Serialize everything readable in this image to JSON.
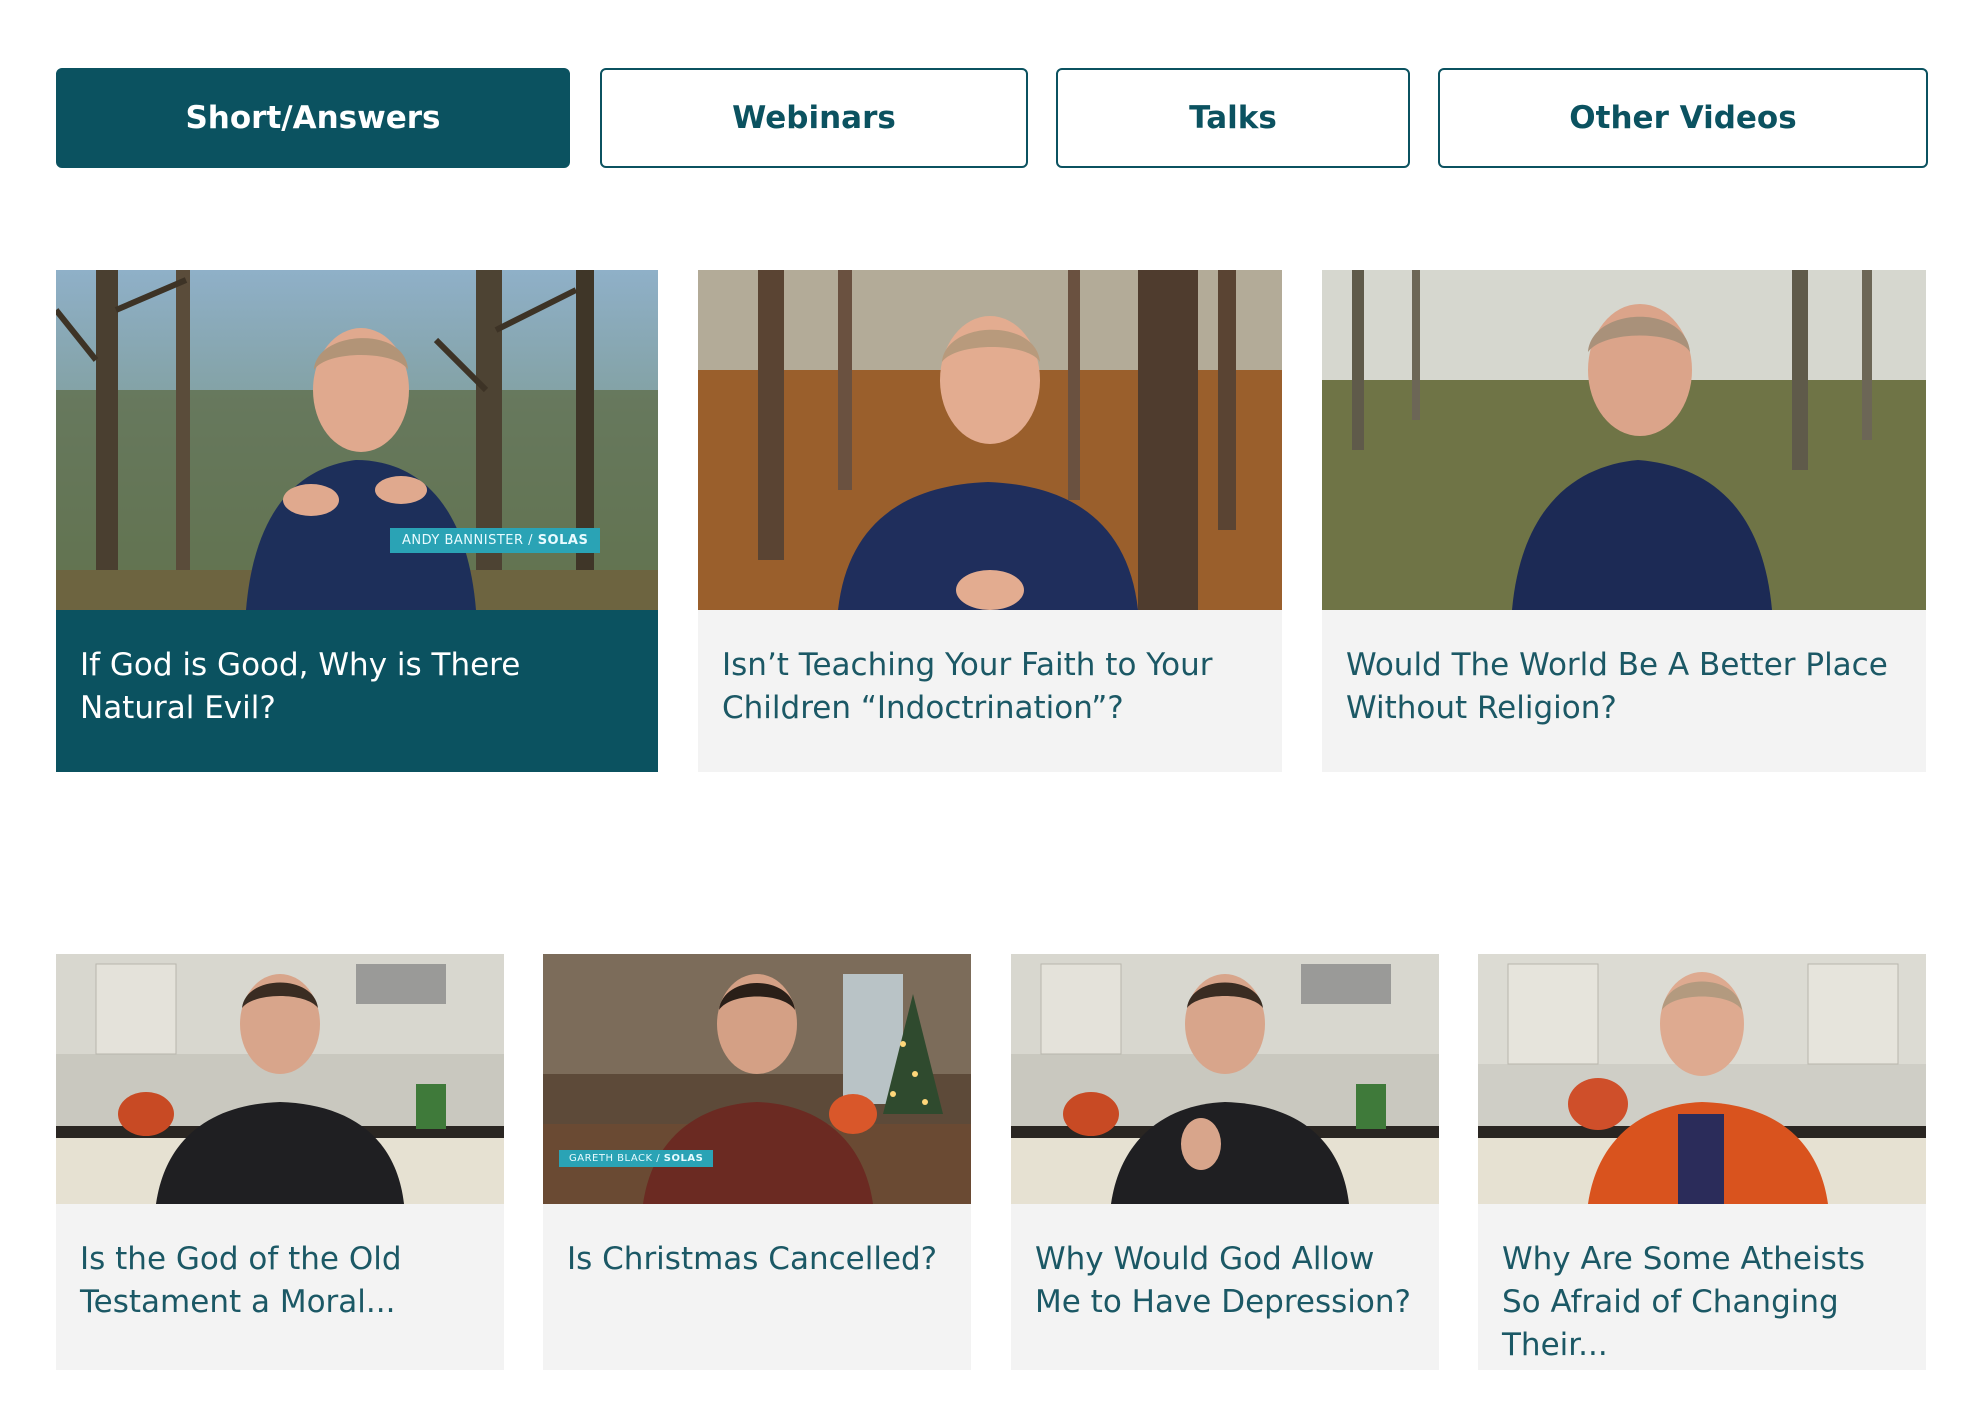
{
  "tabs": [
    {
      "label": "Short/Answers",
      "active": true
    },
    {
      "label": "Webinars",
      "active": false
    },
    {
      "label": "Talks",
      "active": false
    },
    {
      "label": "Other Videos",
      "active": false
    }
  ],
  "row1": [
    {
      "title": "If God is Good, Why is There Natural Evil?",
      "lower_third_name": "ANDY BANNISTER",
      "lower_third_org": "SOLAS",
      "featured": true
    },
    {
      "title": "Isn’t Teaching Your Faith to Your Children “Indoctrination”?"
    },
    {
      "title": "Would The World Be A Better Place Without Religion?"
    }
  ],
  "row2": [
    {
      "title": "Is the God of the Old Testament a Moral..."
    },
    {
      "title": "Is Christmas Cancelled?",
      "lower_third_name": "GARETH BLACK",
      "lower_third_org": "SOLAS"
    },
    {
      "title": "Why Would God Allow Me to Have Depression?"
    },
    {
      "title": "Why Are Some Atheists So Afraid of Changing Their..."
    }
  ],
  "colors": {
    "brand": "#0b5260",
    "card_bg": "#f3f3f3",
    "lower_third": "#2aa3b5"
  }
}
